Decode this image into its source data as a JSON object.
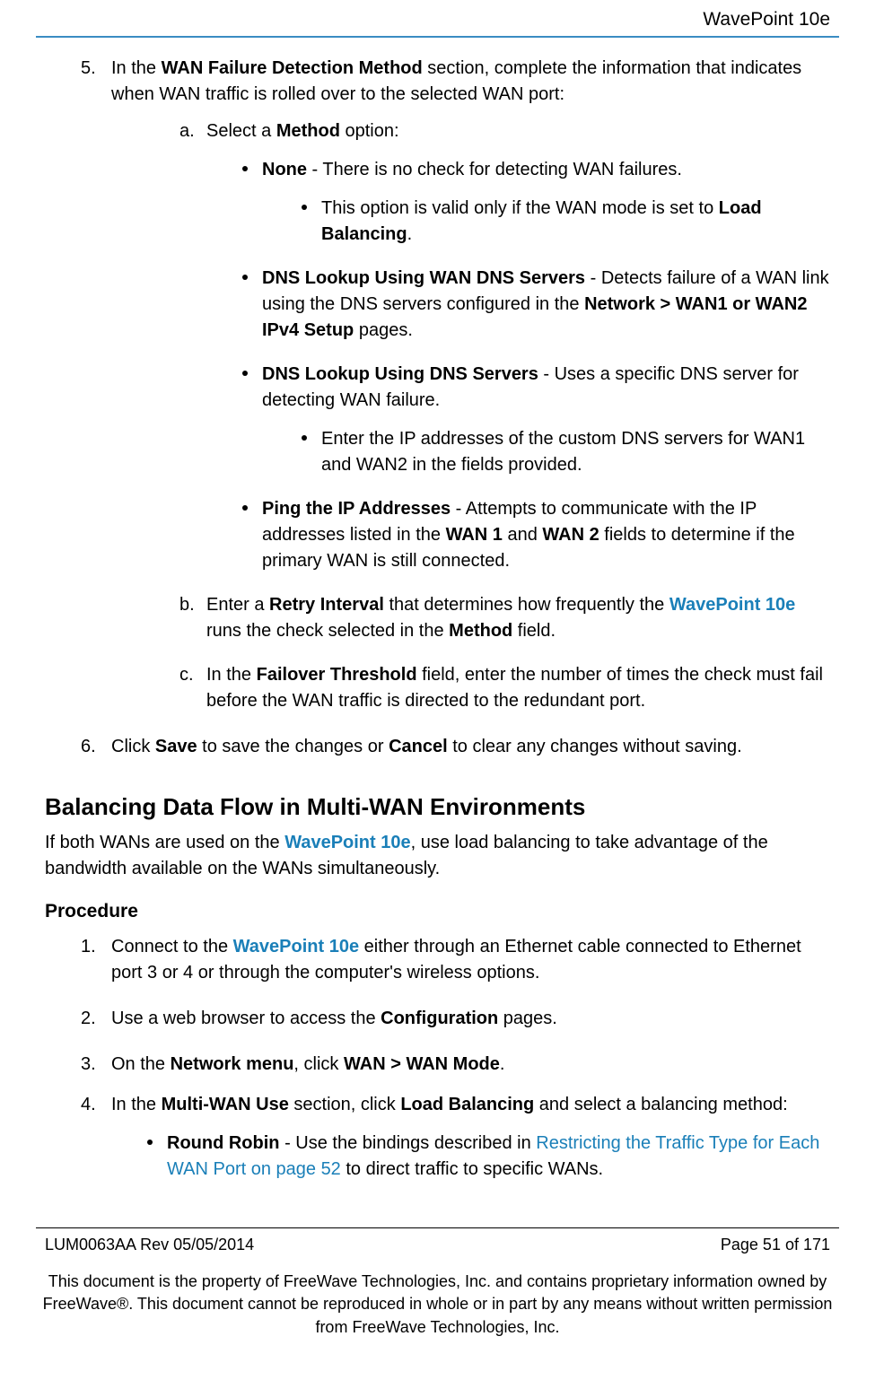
{
  "header": {
    "product": "WavePoint 10e"
  },
  "step5": {
    "num": "5.",
    "lead1": "In the ",
    "bold1": "WAN Failure Detection Method",
    "lead2": " section, complete the information that indicates when WAN traffic is rolled over to the selected WAN port:",
    "a": {
      "num": "a.",
      "t1": "Select a ",
      "b1": "Method",
      "t2": " option:",
      "none": {
        "b": "None",
        "t": " - There is no check for detecting WAN failures.",
        "sub_t1": "This option is valid only if the WAN mode is set to ",
        "sub_b1": "Load Balancing",
        "sub_t2": "."
      },
      "dnsWan": {
        "b1": "DNS Lookup Using WAN DNS Servers",
        "t1": " - Detects failure of a WAN link using the DNS servers configured in the ",
        "b2": "Network > WAN1 or WAN2 IPv4 Setup",
        "t2": " pages."
      },
      "dnsCustom": {
        "b1": "DNS Lookup Using DNS Servers",
        "t1": " - Uses a specific DNS server for detecting WAN failure.",
        "sub": "Enter the IP addresses of the custom DNS servers for WAN1 and WAN2 in the fields provided."
      },
      "ping": {
        "b1": "Ping the IP Addresses",
        "t1": " - Attempts to communicate with the IP addresses listed in the ",
        "b2": "WAN 1",
        "t2": " and ",
        "b3": "WAN 2",
        "t3": " fields to determine if the primary WAN is still connected."
      }
    },
    "b": {
      "num": "b.",
      "t1": "Enter a ",
      "b1": "Retry Interval",
      "t2": " that determines how frequently the ",
      "link": "WavePoint 10e",
      "t3": " runs the check selected in the ",
      "b2": "Method",
      "t4": " field."
    },
    "c": {
      "num": "c.",
      "t1": "In the ",
      "b1": "Failover Threshold",
      "t2": " field, enter the number of times the check must fail before the WAN traffic is directed to the redundant port."
    }
  },
  "step6": {
    "num": "6.",
    "t1": "Click ",
    "b1": "Save",
    "t2": " to save the changes or ",
    "b2": "Cancel",
    "t3": " to clear any changes without saving."
  },
  "section2": {
    "heading": "Balancing Data Flow in Multi-WAN Environments",
    "intro_t1": "If both WANs are used on the ",
    "intro_link": "WavePoint 10e",
    "intro_t2": ", use load balancing to take advantage of the bandwidth available on the WANs simultaneously.",
    "procedure_label": "Procedure",
    "s1": {
      "num": "1.",
      "t1": "Connect to the ",
      "link": "WavePoint 10e",
      "t2": " either through an Ethernet cable connected to Ethernet port 3 or 4 or through the computer's wireless options."
    },
    "s2": {
      "num": "2.",
      "t1": "Use a web browser to access the ",
      "b1": "Configuration",
      "t2": " pages."
    },
    "s3": {
      "num": "3.",
      "t1": "On the ",
      "b1": "Network menu",
      "t2": ", click ",
      "b2": "WAN > WAN Mode",
      "t3": "."
    },
    "s4": {
      "num": "4.",
      "t1": "In the ",
      "b1": "Multi-WAN Use",
      "t2": " section, click ",
      "b2": "Load Balancing",
      "t3": " and select a balancing method:",
      "rr": {
        "b1": "Round Robin",
        "t1": " - Use the bindings described in ",
        "link": "Restricting the Traffic Type for Each WAN Port on page 52",
        "t2": " to direct traffic to specific WANs."
      }
    }
  },
  "footer": {
    "rev": "LUM0063AA Rev 05/05/2014",
    "page": "Page 51 of 171",
    "note": "This document is the property of FreeWave Technologies, Inc. and contains proprietary information owned by FreeWave®. This document cannot be reproduced in whole or in part by any means without written permission from FreeWave Technologies, Inc."
  }
}
